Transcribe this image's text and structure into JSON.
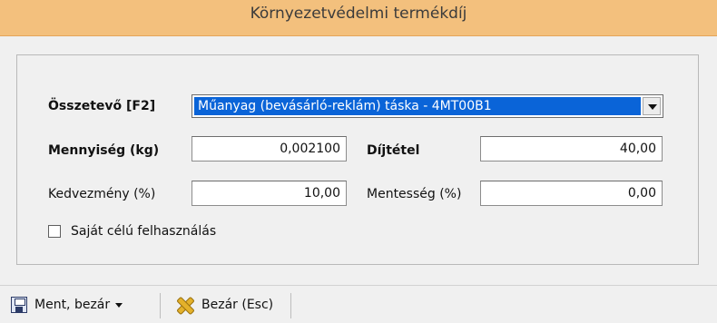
{
  "window": {
    "title": "Környezetvédelmi termékdíj"
  },
  "form": {
    "component": {
      "label": "Összetevő [F2]",
      "value": "Műanyag (bevásárló-reklám) táska - 4MT00B1"
    },
    "quantity": {
      "label": "Mennyiség (kg)",
      "value": "0,002100"
    },
    "rate": {
      "label": "Díjtétel",
      "value": "40,00"
    },
    "discount": {
      "label": "Kedvezmény (%)",
      "value": "10,00"
    },
    "exemption": {
      "label": "Mentesség (%)",
      "value": "0,00"
    },
    "own_use": {
      "label": "Saját célú felhasználás",
      "checked": false
    }
  },
  "toolbar": {
    "save_close_label": "Ment, bezár",
    "close_label": "Bezár (Esc)"
  },
  "icons": {
    "save": "save-icon",
    "close": "close-x-icon",
    "dropdown": "chevron-down-icon"
  },
  "colors": {
    "titlebar": "#f3c07d",
    "selection": "#0a64d8",
    "background": "#f0f0f0"
  }
}
